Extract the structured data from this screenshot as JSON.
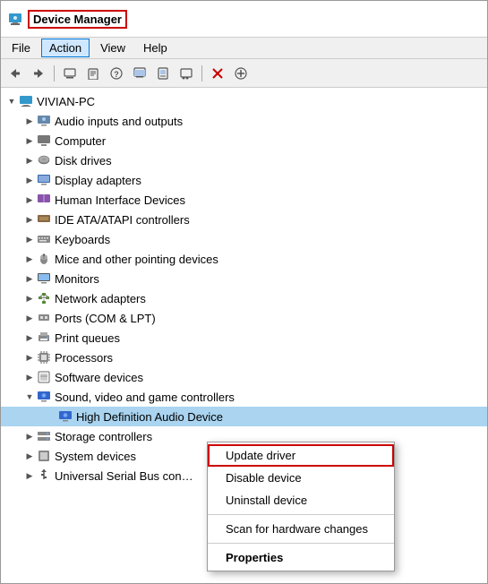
{
  "window": {
    "title": "Device Manager"
  },
  "menuBar": {
    "items": [
      "File",
      "Action",
      "View",
      "Help"
    ]
  },
  "toolbar": {
    "buttons": [
      "◀",
      "▶",
      "☰",
      "📋",
      "❓",
      "🖥",
      "📺",
      "🖨",
      "✖",
      "⊕"
    ]
  },
  "tree": {
    "root": {
      "label": "VIVIAN-PC",
      "expanded": true,
      "children": [
        {
          "id": "audio",
          "label": "Audio inputs and outputs",
          "icon": "audio",
          "expandable": true,
          "expanded": false
        },
        {
          "id": "computer",
          "label": "Computer",
          "icon": "computer",
          "expandable": true,
          "expanded": false
        },
        {
          "id": "disk",
          "label": "Disk drives",
          "icon": "disk",
          "expandable": true,
          "expanded": false
        },
        {
          "id": "display",
          "label": "Display adapters",
          "icon": "display",
          "expandable": true,
          "expanded": false
        },
        {
          "id": "hid",
          "label": "Human Interface Devices",
          "icon": "hid",
          "expandable": true,
          "expanded": false
        },
        {
          "id": "ide",
          "label": "IDE ATA/ATAPI controllers",
          "icon": "ide",
          "expandable": true,
          "expanded": false
        },
        {
          "id": "keyboards",
          "label": "Keyboards",
          "icon": "keyboard",
          "expandable": true,
          "expanded": false
        },
        {
          "id": "mice",
          "label": "Mice and other pointing devices",
          "icon": "mouse",
          "expandable": true,
          "expanded": false
        },
        {
          "id": "monitors",
          "label": "Monitors",
          "icon": "monitor",
          "expandable": true,
          "expanded": false
        },
        {
          "id": "network",
          "label": "Network adapters",
          "icon": "network",
          "expandable": true,
          "expanded": false
        },
        {
          "id": "ports",
          "label": "Ports (COM & LPT)",
          "icon": "ports",
          "expandable": true,
          "expanded": false
        },
        {
          "id": "print",
          "label": "Print queues",
          "icon": "print",
          "expandable": true,
          "expanded": false
        },
        {
          "id": "processors",
          "label": "Processors",
          "icon": "processor",
          "expandable": true,
          "expanded": false
        },
        {
          "id": "software",
          "label": "Software devices",
          "icon": "software",
          "expandable": true,
          "expanded": false
        },
        {
          "id": "sound",
          "label": "Sound, video and game controllers",
          "icon": "sound",
          "expandable": true,
          "expanded": true,
          "children": [
            {
              "id": "hdaudio",
              "label": "High Definition Audio Device",
              "icon": "sound",
              "expandable": false,
              "selected": true
            }
          ]
        },
        {
          "id": "storage",
          "label": "Storage controllers",
          "icon": "storage",
          "expandable": true,
          "expanded": false
        },
        {
          "id": "system",
          "label": "System devices",
          "icon": "system",
          "expandable": true,
          "expanded": false
        },
        {
          "id": "usb",
          "label": "Universal Serial Bus con…",
          "icon": "usb",
          "expandable": true,
          "expanded": false
        }
      ]
    }
  },
  "contextMenu": {
    "items": [
      {
        "id": "update-driver",
        "label": "Update driver",
        "active": true,
        "bold": false
      },
      {
        "id": "disable-device",
        "label": "Disable device",
        "bold": false
      },
      {
        "id": "uninstall-device",
        "label": "Uninstall device",
        "bold": false
      },
      {
        "id": "sep1",
        "type": "separator"
      },
      {
        "id": "scan",
        "label": "Scan for hardware changes",
        "bold": false
      },
      {
        "id": "sep2",
        "type": "separator"
      },
      {
        "id": "properties",
        "label": "Properties",
        "bold": true
      }
    ]
  }
}
